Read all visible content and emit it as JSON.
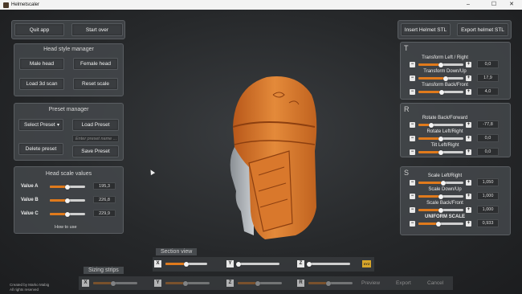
{
  "window": {
    "title": "Helmetscaler",
    "minimize": "–",
    "maximize": "☐",
    "close": "✕"
  },
  "top_left": {
    "quit": "Quit app",
    "start_over": "Start over"
  },
  "head_style": {
    "title": "Head style manager",
    "male": "Male head",
    "female": "Female head",
    "load_scan": "Load 3d scan",
    "reset_scale": "Reset scale"
  },
  "preset": {
    "title": "Preset manager",
    "select": "Select Preset",
    "select_arrow": "▾",
    "load": "Load Preset",
    "name_placeholder": "Enter preset name ...",
    "delete": "Delete preset",
    "save": "Save Preset"
  },
  "head_scale": {
    "title": "Head scale values",
    "rows": [
      {
        "label": "Value A",
        "value": "195,3",
        "level": 0.5
      },
      {
        "label": "Value B",
        "value": "226,8",
        "level": 0.5
      },
      {
        "label": "Value C",
        "value": "229,9",
        "level": 0.5
      }
    ],
    "howto": "How to use"
  },
  "top_right": {
    "insert": "Insert Helmet STL",
    "export": "Export helmet STL"
  },
  "translate": {
    "letter": "T",
    "rows": [
      {
        "label": "Transform Left / Right",
        "value": "0,0",
        "level": 0.5
      },
      {
        "label": "Transform Down/Up",
        "value": "17,9",
        "level": 0.6
      },
      {
        "label": "Transform Back/Front",
        "value": "4,0",
        "level": 0.52
      }
    ]
  },
  "rotate": {
    "letter": "R",
    "rows": [
      {
        "label": "Rotate Back/Forward",
        "value": "-77,8",
        "level": 0.28
      },
      {
        "label": "Rotate Left/Right",
        "value": "0,0",
        "level": 0.5
      },
      {
        "label": "Tilt Left/Right",
        "value": "0,0",
        "level": 0.5
      }
    ]
  },
  "scale": {
    "letter": "S",
    "rows": [
      {
        "label": "Scale Left/Right",
        "value": "1,050",
        "level": 0.55
      },
      {
        "label": "Scale Down/Up",
        "value": "1,000",
        "level": 0.5
      },
      {
        "label": "Scale Back/Front",
        "value": "1,000",
        "level": 0.5
      },
      {
        "label": "UNIFORM SCALE",
        "value": "0,933",
        "level": 0.45
      }
    ]
  },
  "minus": "−",
  "plus": "+",
  "section_view": {
    "title": "Section view",
    "x": "X",
    "y": "Y",
    "z": "Z",
    "xyz": "XYZ"
  },
  "sizing": {
    "title": "Sizing strips",
    "x": "X",
    "y": "Y",
    "z": "Z",
    "r": "R",
    "preview": "Preview",
    "export": "Export",
    "cancel": "Cancel"
  },
  "credits": {
    "line1": "Created by Marko Mabig",
    "line2": "All rights reserved"
  }
}
